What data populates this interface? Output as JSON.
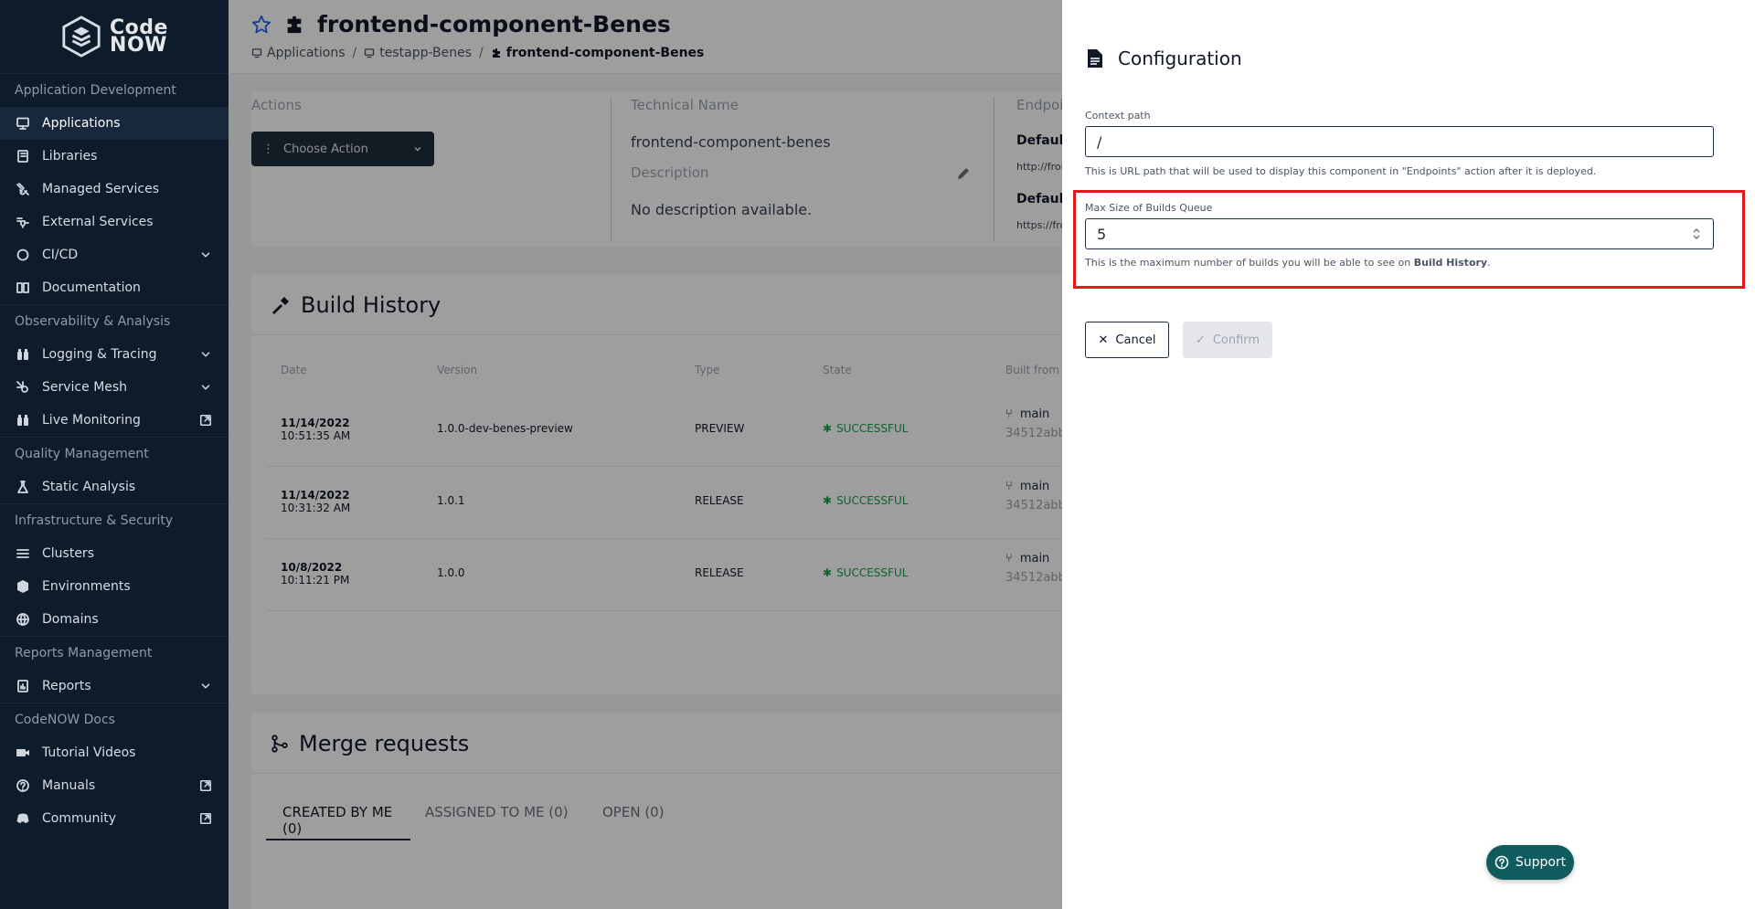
{
  "brand": {
    "logo_line1": "Code",
    "logo_line2": "NOW"
  },
  "sidebar": {
    "sections": [
      {
        "title": "Application Development",
        "items": [
          {
            "label": "Applications",
            "icon": "monitor-icon",
            "active": true
          },
          {
            "label": "Libraries",
            "icon": "book-icon"
          },
          {
            "label": "Managed Services",
            "icon": "plug-icon"
          },
          {
            "label": "External Services",
            "icon": "external-plug-icon"
          },
          {
            "label": "CI/CD",
            "icon": "cycle-icon",
            "expandable": true
          },
          {
            "label": "Documentation",
            "icon": "open-book-icon"
          }
        ]
      },
      {
        "title": "Observability & Analysis",
        "items": [
          {
            "label": "Logging & Tracing",
            "icon": "binoculars-icon",
            "expandable": true
          },
          {
            "label": "Service Mesh",
            "icon": "mesh-icon",
            "expandable": true
          },
          {
            "label": "Live Monitoring",
            "icon": "binoculars-icon",
            "external": true
          }
        ]
      },
      {
        "title": "Quality Management",
        "items": [
          {
            "label": "Static Analysis",
            "icon": "flask-icon"
          }
        ]
      },
      {
        "title": "Infrastructure & Security",
        "items": [
          {
            "label": "Clusters",
            "icon": "list-icon"
          },
          {
            "label": "Environments",
            "icon": "cube-icon"
          },
          {
            "label": "Domains",
            "icon": "globe-icon"
          }
        ]
      },
      {
        "title": "Reports Management",
        "items": [
          {
            "label": "Reports",
            "icon": "report-icon",
            "expandable": true
          }
        ]
      },
      {
        "title": "CodeNOW Docs",
        "items": [
          {
            "label": "Tutorial Videos",
            "icon": "video-icon"
          },
          {
            "label": "Manuals",
            "icon": "help-circle-icon",
            "external": true
          },
          {
            "label": "Community",
            "icon": "discord-icon",
            "external": true
          }
        ]
      }
    ]
  },
  "header": {
    "title": "frontend-component-Benes",
    "breadcrumb": [
      "Applications",
      "testapp-Benes",
      "frontend-component-Benes"
    ]
  },
  "info": {
    "actions_label": "Actions",
    "choose_action": "Choose Action",
    "technical_name_label": "Technical Name",
    "technical_name": "frontend-component-benes",
    "description_label": "Description",
    "description": "No description available.",
    "endpoints_label": "Endpoi",
    "endpoint1_label": "Default I",
    "endpoint1_value": "http://fron",
    "endpoint2_label": "Default E",
    "endpoint2_value": "https://fro"
  },
  "build_history": {
    "title": "Build History",
    "columns": [
      "Date",
      "Version",
      "Type",
      "State",
      "Built from"
    ],
    "rows": [
      {
        "date": "11/14/2022",
        "time": "10:51:35 AM",
        "version": "1.0.0-dev-benes-preview",
        "type": "PREVIEW",
        "state": "SUCCESSFUL",
        "branch": "main",
        "commit": "34512abb"
      },
      {
        "date": "11/14/2022",
        "time": "10:31:32 AM",
        "version": "1.0.1",
        "type": "RELEASE",
        "state": "SUCCESSFUL",
        "branch": "main",
        "commit": "34512abb"
      },
      {
        "date": "10/8/2022",
        "time": "10:11:21 PM",
        "version": "1.0.0",
        "type": "RELEASE",
        "state": "SUCCESSFUL",
        "branch": "main",
        "commit": "34512abb"
      }
    ]
  },
  "merge_requests": {
    "title": "Merge requests",
    "tabs": [
      "CREATED BY ME (0)",
      "ASSIGNED TO ME (0)",
      "OPEN (0)"
    ]
  },
  "drawer": {
    "title": "Configuration",
    "context_path_label": "Context path",
    "context_path_value": "/",
    "context_path_help": "This is URL path that will be used to display this component in \"Endpoints\" action after it is deployed.",
    "queue_label": "Max Size of Builds Queue",
    "queue_value": "5",
    "queue_help_prefix": "This is the maximum number of builds you will be able to see on ",
    "queue_help_bold": "Build History",
    "queue_help_suffix": ".",
    "cancel": "Cancel",
    "confirm": "Confirm"
  },
  "support": {
    "label": "Support"
  },
  "colors": {
    "sidebar_bg": "#0e1b2b",
    "highlight": "#e01919",
    "success": "#16a34a",
    "support_bg": "#0f5b5e"
  }
}
